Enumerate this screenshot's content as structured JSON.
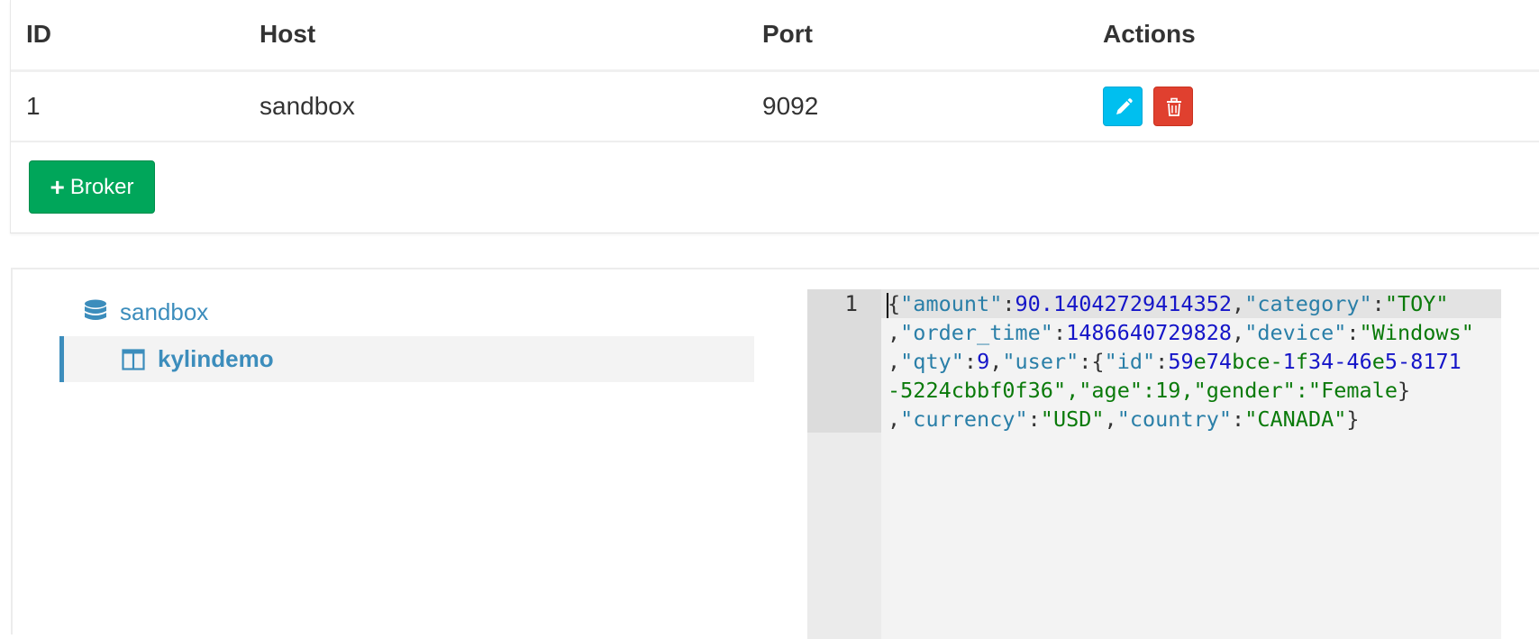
{
  "brokers_table": {
    "headers": {
      "id": "ID",
      "host": "Host",
      "port": "Port",
      "actions": "Actions"
    },
    "rows": [
      {
        "id": "1",
        "host": "sandbox",
        "port": "9092"
      }
    ],
    "action_icons": {
      "edit": "pencil-icon",
      "delete": "trash-icon"
    },
    "colors": {
      "edit_button": "#00bfef",
      "delete_button": "#e0402f"
    }
  },
  "add_broker_button": {
    "icon": "plus-icon",
    "label": "Broker",
    "color": "#00a65a"
  },
  "tree": {
    "database": {
      "icon": "database-icon",
      "label": "sandbox"
    },
    "table": {
      "icon": "table-columns-icon",
      "label": "kylindemo",
      "selected": true
    },
    "accent_color": "#3c8dbc"
  },
  "code_viewer": {
    "line_number": "1",
    "lines": [
      "{\"amount\":90.14042729414352,\"category\":\"TOY\"",
      ",\"order_time\":1486640729828,\"device\":\"Windows\"",
      ",\"qty\":9,\"user\":{\"id\":\"59e74bce-1f34-46e5-8171",
      "-5224cbbf0f36\",\"age\":19,\"gender\":\"Female\"}",
      ",\"currency\":\"USD\",\"country\":\"CANADA\"}"
    ],
    "colors": {
      "key": "#2a7fa8",
      "number": "#1515c8",
      "string": "#0a7a0a"
    }
  }
}
